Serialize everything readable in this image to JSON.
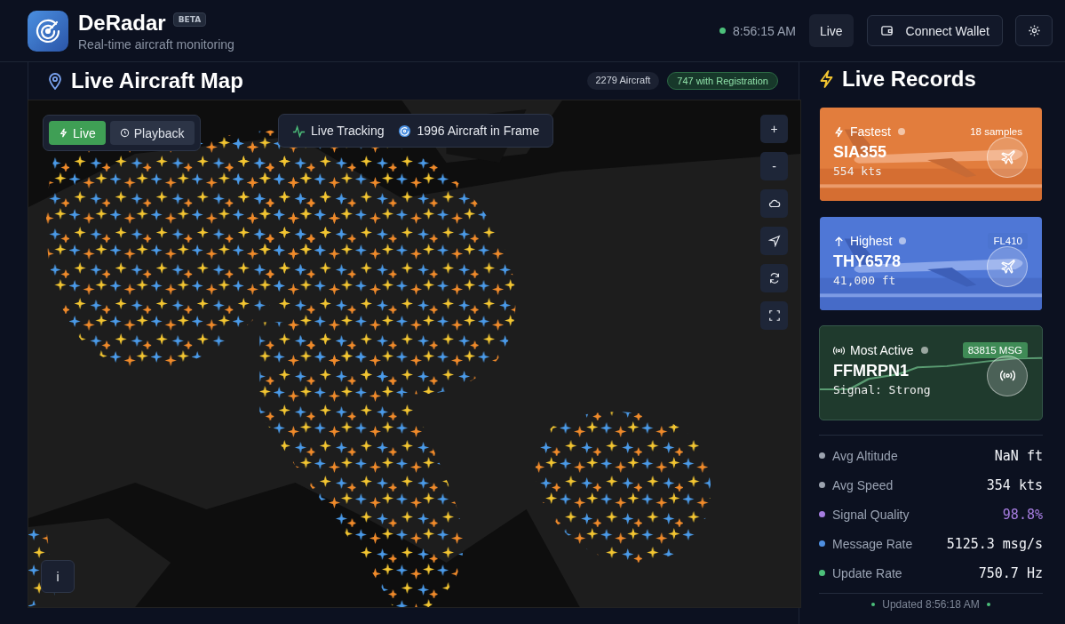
{
  "header": {
    "app_name": "DeRadar",
    "badge": "BETA",
    "subtitle": "Real-time aircraft monitoring",
    "connected": true,
    "time": "8:56:15 AM",
    "live_button": "Live",
    "wallet_button": "Connect Wallet"
  },
  "map_panel": {
    "title": "Live Aircraft Map",
    "counts": [
      {
        "label": "2279 Aircraft",
        "kind": "neutral"
      },
      {
        "label": "747 with Registration",
        "kind": "success"
      }
    ],
    "modes": [
      {
        "label": "Live",
        "selected": true
      },
      {
        "label": "Playback",
        "selected": false
      }
    ],
    "tracking": {
      "label": "Live Tracking",
      "frame_count": "1996 Aircraft in Frame"
    },
    "map_controls": [
      {
        "kind": "text",
        "label": "+"
      },
      {
        "kind": "text",
        "label": "-"
      },
      {
        "kind": "cloud"
      },
      {
        "kind": "navigate"
      },
      {
        "kind": "refresh"
      },
      {
        "kind": "fullscreen"
      }
    ],
    "info_button": "i"
  },
  "records": {
    "title": "Live Records",
    "cards": [
      {
        "kind": "fastest",
        "label": "Fastest",
        "badge": "18 samples",
        "callsign": "SIA355",
        "detail": "554 kts"
      },
      {
        "kind": "highest",
        "label": "Highest",
        "badge": "FL410",
        "callsign": "THY6578",
        "detail": "41,000 ft"
      },
      {
        "kind": "active",
        "label": "Most Active",
        "badge": "83815 MSG",
        "callsign": "FFMRPN1",
        "detail": "Signal: Strong"
      }
    ],
    "stats": [
      {
        "label": "Avg Altitude",
        "value": "NaN ft",
        "color": "#9ca3af",
        "highlight": false
      },
      {
        "label": "Avg Speed",
        "value": "354 kts",
        "color": "#9ca3af",
        "highlight": false
      },
      {
        "label": "Signal Quality",
        "value": "98.8%",
        "color": "#a67de0",
        "highlight": true
      },
      {
        "label": "Message Rate",
        "value": "5125.3 msg/s",
        "color": "#4f8fe0",
        "highlight": false
      },
      {
        "label": "Update Rate",
        "value": "750.7 Hz",
        "color": "#4cc07a",
        "highlight": false
      }
    ],
    "updated": "Updated 8:56:18 AM"
  }
}
